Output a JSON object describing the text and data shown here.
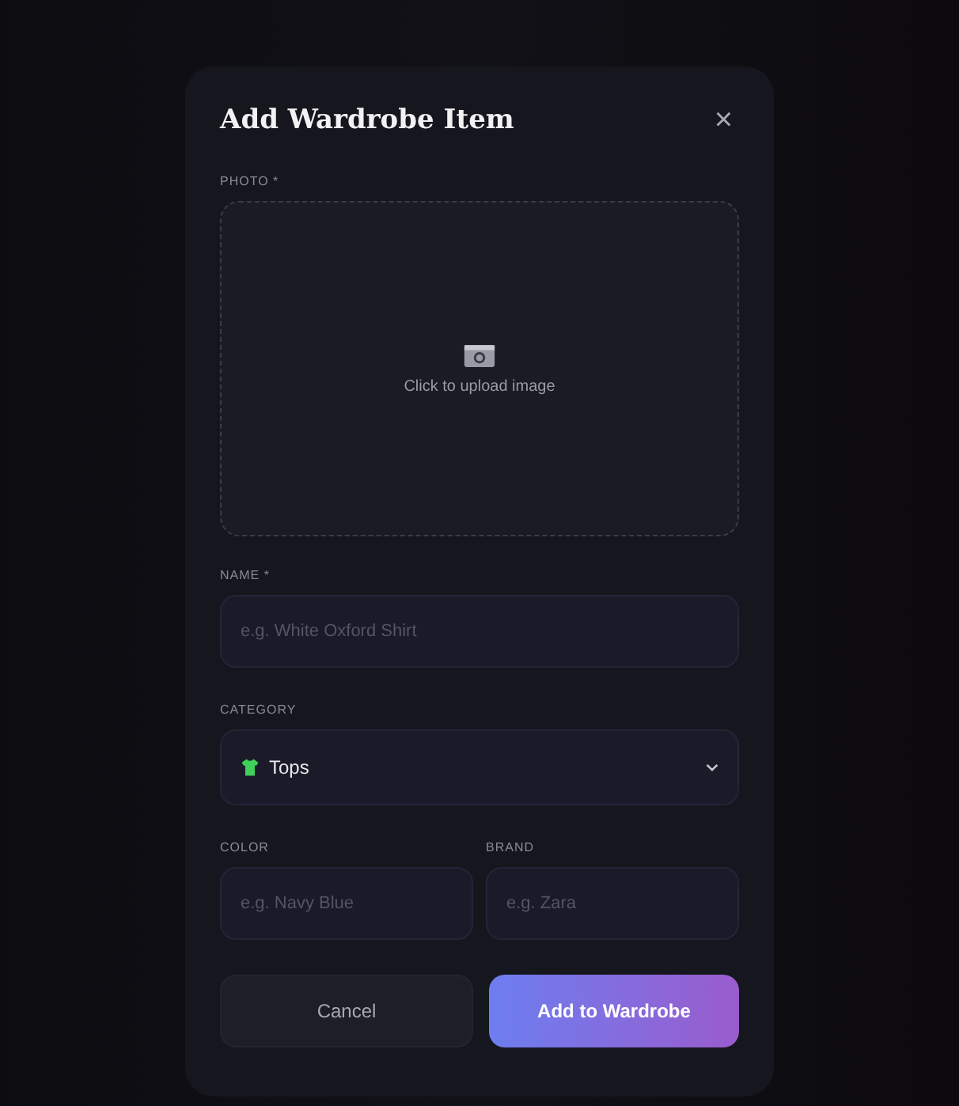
{
  "dialog": {
    "title": "Add Wardrobe Item",
    "close": "×"
  },
  "photo": {
    "label": "PHOTO *",
    "hint": "Click to upload image"
  },
  "name": {
    "label": "NAME *",
    "placeholder": "e.g. White Oxford Shirt"
  },
  "category": {
    "label": "CATEGORY",
    "value": "Tops"
  },
  "color": {
    "label": "COLOR",
    "placeholder": "e.g. Navy Blue"
  },
  "brand": {
    "label": "BRAND",
    "placeholder": "e.g. Zara"
  },
  "buttons": [
    {
      "label": "Cancel",
      "kind": "secondary"
    },
    {
      "label": "Add to Wardrobe",
      "kind": "primary"
    }
  ]
}
